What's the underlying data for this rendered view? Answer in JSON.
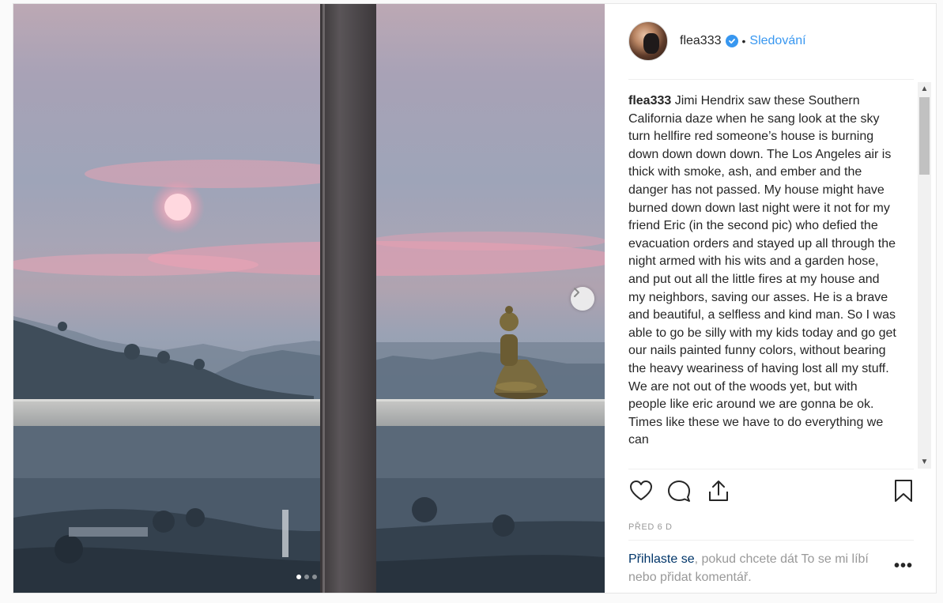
{
  "post": {
    "username": "flea333",
    "bullet": "•",
    "follow_label": "Sledování",
    "caption_author": "flea333",
    "caption_text": "Jimi Hendrix saw these Southern California daze when he sang look at the sky turn hellfire red someone’s house is burning down down down down. The Los Angeles air is thick with smoke, ash, and ember and the danger has not passed. My house might have burned down down last night were it not for my friend Eric (in the second pic) who defied the evacuation orders and stayed up all through the night armed with his wits and a garden hose, and put out all the little fires at my house and my neighbors, saving our asses. He is a brave and beautiful, a selfless and kind man. So I was able to go be silly with my kids today and go get our nails painted funny colors, without bearing the heavy weariness of having lost all my stuff. We are not out of the woods yet, but with people like eric around we are gonna be ok. Times like these we have to do everything we can",
    "timestamp": "PŘED 6 D",
    "login_link": "Přihlaste se",
    "login_rest": ", pokud chcete dát To se mi líbí nebo přidat komentář.",
    "more_label": "•••"
  },
  "carousel": {
    "total_slides": 3,
    "active_slide": 1
  },
  "icons": {
    "verified": "verified-badge-icon",
    "next": "chevron-right-icon",
    "like": "heart-icon",
    "comment": "comment-bubble-icon",
    "share": "share-upload-icon",
    "save": "bookmark-icon",
    "more": "more-options-icon"
  },
  "colors": {
    "accent": "#3897f0",
    "text": "#262626",
    "muted": "#999999",
    "link_dark": "#003569",
    "border": "#efefef"
  }
}
